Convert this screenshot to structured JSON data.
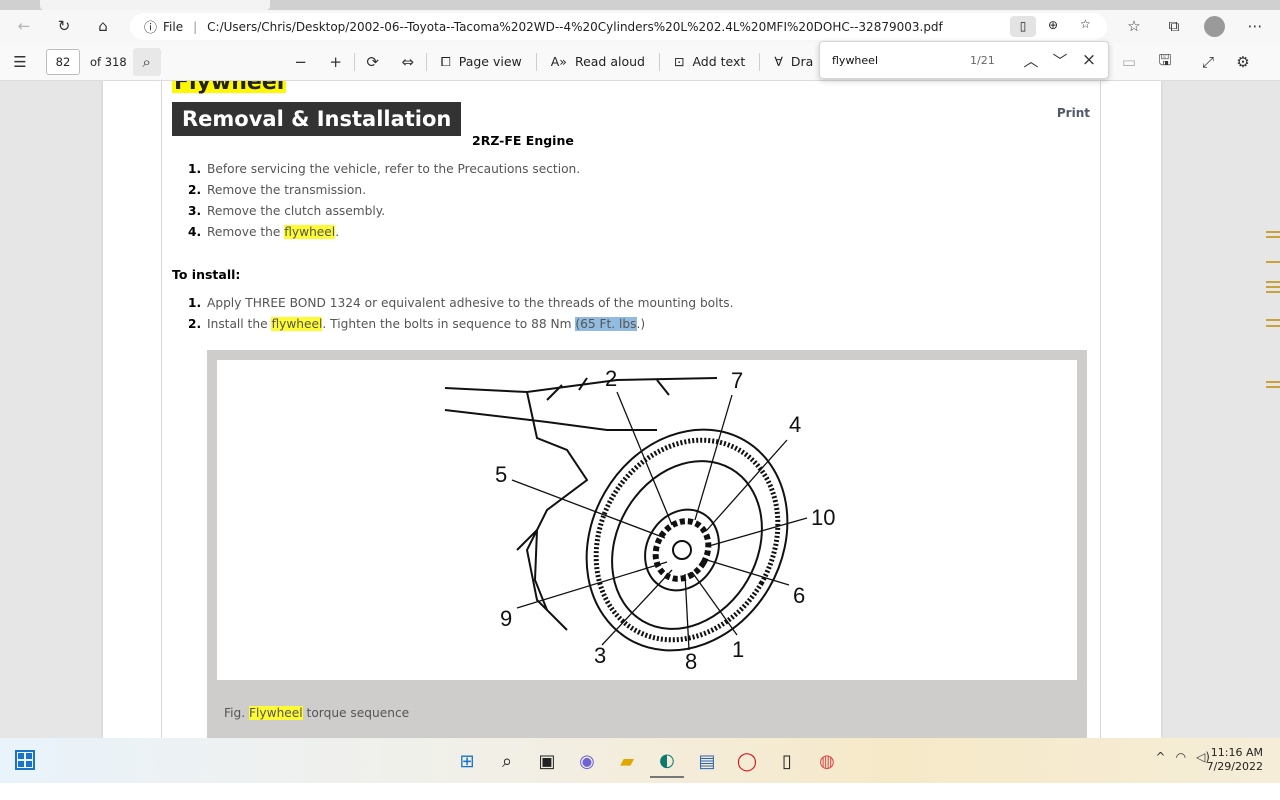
{
  "browser": {
    "url_scheme": "File",
    "url": "C:/Users/Chris/Desktop/2002-06--Toyota--Tacoma%202WD--4%20Cylinders%20L%202.4L%20MFI%20DOHC--32879003.pdf",
    "more_icon": "⋯"
  },
  "pdf_toolbar": {
    "page_number": "82",
    "page_total": "of 318",
    "page_view_label": "Page view",
    "read_aloud_label": "Read aloud",
    "add_text_label": "Add text",
    "draw_label": "Dra"
  },
  "find": {
    "query": "flywheel",
    "count": "1/21"
  },
  "document": {
    "section_title": "Flywheel",
    "banner": "Removal & Installation",
    "print_link": "Print",
    "engine": "2RZ-FE Engine",
    "removal_steps": [
      {
        "n": "1.",
        "text": "Before servicing the vehicle, refer to the Precautions section."
      },
      {
        "n": "2.",
        "text": "Remove the transmission."
      },
      {
        "n": "3.",
        "text": "Remove the clutch assembly."
      },
      {
        "n": "4.",
        "pre": "Remove the ",
        "hl": "flywheel",
        "post": "."
      }
    ],
    "install_title": "To install:",
    "install_steps": [
      {
        "n": "1.",
        "text": "Apply THREE BOND 1324 or equivalent adhesive to the threads of the mounting bolts."
      },
      {
        "n": "2.",
        "pre": "Install the ",
        "hl": "flywheel",
        "mid": ". Tighten the bolts in sequence to 88 Nm ",
        "sel": "(65 Ft. lbs",
        "post": ".)"
      }
    ],
    "figure_numbers": [
      "1",
      "2",
      "3",
      "4",
      "5",
      "6",
      "7",
      "8",
      "9",
      "10"
    ],
    "caption_pre": "Fig. ",
    "caption_hl": "Flywheel",
    "caption_post": " torque sequence"
  },
  "taskbar": {
    "time": "11:16 AM",
    "date": "7/29/2022"
  }
}
